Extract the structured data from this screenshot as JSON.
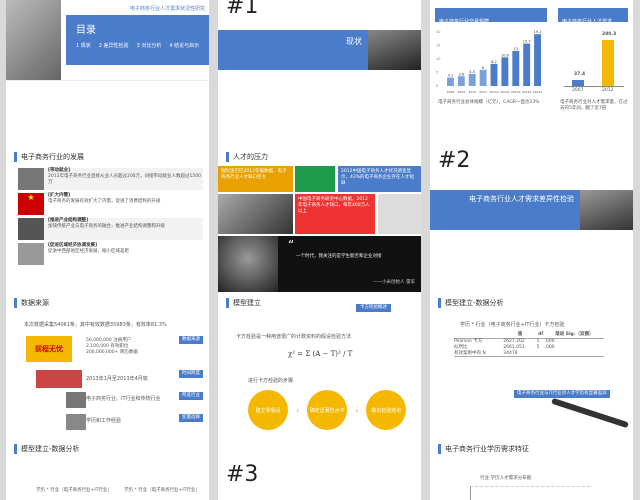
{
  "s0": {
    "header": "电子商务行业人才需求状况性研究",
    "toc_title": "目录",
    "items": [
      "1 现状",
      "2 差异性检验",
      "3 对比分析",
      "4 结论与启示"
    ]
  },
  "s1": {
    "num": "#1",
    "title": "现状"
  },
  "s2": {
    "left_title": "电子商务行业交易规模",
    "left_caption": "电子商务行业总体规模（亿元），CAGR一直达13%",
    "right_title": "电子商务行业人才需求",
    "right_caption": "电子商务行业对人才需求量，在过去的5年间，翻了近7倍",
    "right_years": [
      "2007",
      "2012"
    ],
    "right_values": [
      "37.4",
      "280.3"
    ]
  },
  "s3": {
    "title": "电子商务行业的发展",
    "items": [
      {
        "head": "[带动就业]",
        "text": "2012年电子商务行业直接从业人员超过200万，间接带动就业人数超过1500万"
      },
      {
        "head": "[扩大内需]",
        "text": "电子商务的发展有效扩大了内需，促进了消费结构的升级"
      },
      {
        "head": "[推进产业结构调整]",
        "text": "加快传统产业与电子商务的融合，推进产业结构调整和升级"
      },
      {
        "head": "[促进区域经济协调发展]",
        "text": "促进中西部地区经济发展，缩小区域差距"
      }
    ]
  },
  "s4": {
    "title": "人才的压力",
    "box1": "据阿里巴巴2012年报数据，电子商务行业人才缺口巨大",
    "box2": "2012中国电子商务人才状况调查显示，43%的电子商务企业存在人才短缺",
    "box3": "中国电子商务研究中心数据，2012年电子商务人才缺口，每年400万人以上",
    "quote": "一个时代，我关注的是学生能否和企业对接",
    "author": "——小米创始人 雷军"
  },
  "s5": {
    "num": "#2",
    "title": "电子商务行业人才需求差异性检验"
  },
  "s6": {
    "title": "数据来源",
    "intro": "本次数据采集54061条，其中有效数据35983条，有效率81.3%",
    "stats": [
      "56,000,000 注册用户",
      "2,100,000 有效职位",
      "200,000,000+ 简历数据"
    ],
    "time": "2013年1月至2013年4月底",
    "industry": "电子商务行业、IT行业和传统行业",
    "edu": "学历和工作经验",
    "tags": [
      "数据来源",
      "时间跨度",
      "所选行业",
      "变量选择"
    ]
  },
  "s7": {
    "title": "模型建立",
    "tag": "卡方检验概述",
    "desc": "卡方检验是一种用途很广的计数资料的假设检验方法",
    "formula": "χ² = Σ (A − T)² / T",
    "steps_title": "进行卡方检验的步骤",
    "steps": [
      "建立零假设",
      "确定显著性水平",
      "做出检验结论"
    ]
  },
  "s8": {
    "title": "模型建立-数据分析",
    "table_title": "学历 * 行业（电子商务行业+IT行业）卡方检验",
    "headers": [
      "",
      "值",
      "df",
      "渐进 Sig.（双侧）"
    ],
    "rows": [
      [
        "Pearson 卡方",
        "2627.202",
        "5",
        ".000"
      ],
      [
        "似然比",
        "2661.051",
        "5",
        ".000"
      ],
      [
        "有效案例中的 N",
        "34478",
        "",
        ""
      ]
    ],
    "note": "电子商务行业与IT行业对人才学历有显著差异"
  },
  "s9": {
    "title": "模型建立-数据分析",
    "caption": "学历 * 行业（电子商务行业+IT行业）"
  },
  "s10": {
    "num": "#3"
  },
  "s11": {
    "title": "电子商务行业学历需求特征",
    "caption": "行业-学历人才需求分布图"
  },
  "chart_left": {
    "categories": [
      "2008",
      "2009",
      "2010",
      "2011",
      "2011e",
      "2012e",
      "2013e",
      "2014e",
      "2015e"
    ],
    "values": [
      3.1,
      3.6,
      4.5,
      6.0,
      8.2,
      10.6,
      13.0,
      15.7,
      19.2
    ]
  }
}
